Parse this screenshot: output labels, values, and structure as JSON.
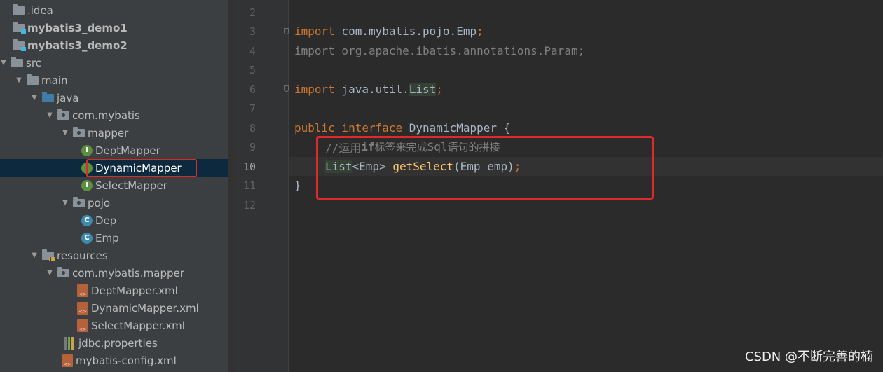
{
  "project_tree": {
    "items": [
      {
        "label": ".idea"
      },
      {
        "label": "mybatis3_demo1"
      },
      {
        "label": "mybatis3_demo2"
      },
      {
        "label": "src"
      },
      {
        "label": "main"
      },
      {
        "label": "java"
      },
      {
        "label": "com.mybatis"
      },
      {
        "label": "mapper"
      },
      {
        "label": "DeptMapper",
        "icon_letter": "I"
      },
      {
        "label": "DynamicMapper",
        "icon_letter": "I"
      },
      {
        "label": "SelectMapper",
        "icon_letter": "I"
      },
      {
        "label": "pojo"
      },
      {
        "label": "Dep",
        "icon_letter": "C"
      },
      {
        "label": "Emp",
        "icon_letter": "C"
      },
      {
        "label": "resources"
      },
      {
        "label": "com.mybatis.mapper"
      },
      {
        "label": "DeptMapper.xml",
        "icon_text": "<>"
      },
      {
        "label": "DynamicMapper.xml",
        "icon_text": "<>"
      },
      {
        "label": "SelectMapper.xml",
        "icon_text": "<>"
      },
      {
        "label": "jdbc.properties"
      },
      {
        "label": "mybatis-config.xml",
        "icon_text": "<>"
      }
    ],
    "selected_label": "DynamicMapper"
  },
  "editor": {
    "line_numbers": [
      "2",
      "3",
      "4",
      "5",
      "6",
      "7",
      "8",
      "9",
      "10",
      "11",
      "12"
    ],
    "current_line": "10",
    "lines": {
      "l3": {
        "kw": "import",
        "rest": " com.mybatis.pojo.Emp",
        "semi": ";"
      },
      "l4": {
        "text": "import org.apache.ibatis.annotations.Param;"
      },
      "l6": {
        "kw": "import",
        "rest": " java.util.",
        "type": "List",
        "semi": ";"
      },
      "l8": {
        "kw": "public interface",
        "rest": " DynamicMapper {"
      },
      "l9": {
        "prefix": "//运用",
        "bold": "if",
        "mid": "标签来完成",
        "sql": "Sql",
        "suffix": "语句的拼接"
      },
      "l10": {
        "type_a": "Li",
        "type_b": "st",
        "generic": "<Emp> ",
        "method": "getSelect",
        "params": "(Emp emp)",
        "semi": ";"
      },
      "l11": {
        "text": "}"
      }
    }
  },
  "watermark": "CSDN @不断完善的楠",
  "colors": {
    "highlight_box": "#e02a2a",
    "keyword": "#cc7832",
    "method": "#ffc66d",
    "comment": "#808080",
    "default_text": "#a9b7c6",
    "tree_bg": "#3c3f41",
    "editor_bg": "#2b2b2b",
    "selection": "#0d293e"
  }
}
